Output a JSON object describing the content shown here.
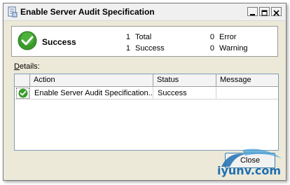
{
  "window": {
    "title": "Enable Server Audit Specification"
  },
  "summary": {
    "status": "Success",
    "total_count": "1",
    "total_label": "Total",
    "success_count": "1",
    "success_label": "Success",
    "error_count": "0",
    "error_label": "Error",
    "warning_count": "0",
    "warning_label": "Warning"
  },
  "details": {
    "label_accel": "D",
    "label_rest": "etails:",
    "columns": [
      "Action",
      "Status",
      "Message"
    ],
    "rows": [
      {
        "icon": "success-check-icon",
        "action": "Enable Server Audit Specification...",
        "status": "Success",
        "message": ""
      }
    ]
  },
  "buttons": {
    "close_label": "Close"
  },
  "watermark": {
    "text": "iyunv.com"
  },
  "colors": {
    "success_green": "#3a9a2a",
    "accent_blue": "#3c7fb1"
  }
}
